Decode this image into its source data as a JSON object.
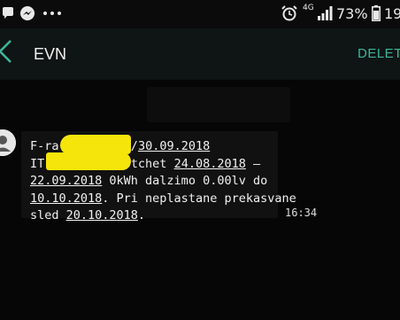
{
  "status_bar": {
    "icons": [
      "chat-bubble-icon",
      "messenger-icon",
      "more-dots-icon",
      "alarm-icon",
      "4g-icon",
      "signal-icon",
      "battery-icon"
    ],
    "network": "4G",
    "battery": "73%",
    "time": "19"
  },
  "app_bar": {
    "title": "EVN",
    "delete_label": "DELETE"
  },
  "message": {
    "line1_prefix": "F-ra",
    "line1_suffix": "/",
    "line1_date": "30.09.2018",
    "line2_prefix": "IT",
    "line2_suffix": "otchet ",
    "line2_date": "24.08.2018",
    "line2_end": " –",
    "line3_date": "22.09.2018",
    "line3_text": " 0kWh dalzimo 0.00lv do",
    "line4_date": "10.10.2018",
    "line4_text": ". Pri neplastane prekasvane",
    "line5_text": "sled ",
    "line5_date": "20.10.2018",
    "line5_end": ".",
    "time": "16:34"
  },
  "colors": {
    "accent": "#3fb59a",
    "redaction": "#f5e50b",
    "background": "#050505"
  }
}
